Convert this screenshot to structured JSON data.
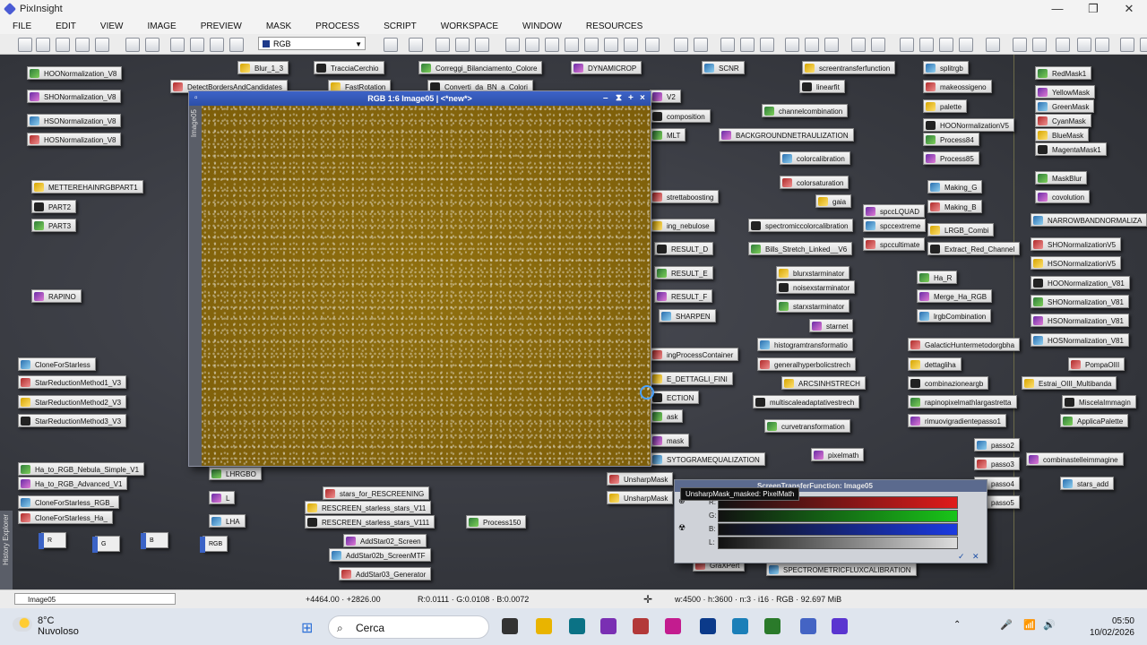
{
  "window": {
    "title": "PixInsight"
  },
  "menu": [
    "FILE",
    "EDIT",
    "VIEW",
    "IMAGE",
    "PREVIEW",
    "MASK",
    "PROCESS",
    "SCRIPT",
    "WORKSPACE",
    "WINDOW",
    "RESOURCES"
  ],
  "toolbar": {
    "rgb_select": "RGB"
  },
  "image_window": {
    "title": "RGB 1:6 Image05 | <*new*>",
    "side_label": "Image05"
  },
  "icons": [
    [
      "HOONormalization_V8",
      30,
      13
    ],
    [
      "SHONormalization_V8",
      30,
      39
    ],
    [
      "HSONormalization_V8",
      30,
      66
    ],
    [
      "HOSNormalization_V8",
      30,
      87
    ],
    [
      "METTEREHAINRGBPART1",
      35,
      140
    ],
    [
      "PART2",
      35,
      162
    ],
    [
      "PART3",
      35,
      183
    ],
    [
      "RAPINO",
      35,
      262
    ],
    [
      "CloneForStarless",
      20,
      338
    ],
    [
      "StarReductionMethod1_V3",
      20,
      358
    ],
    [
      "StarReductionMethod2_V3",
      20,
      380
    ],
    [
      "StarReductionMethod3_V3",
      20,
      401
    ],
    [
      "Ha_to_RGB_Nebula_Simple_V1",
      20,
      455
    ],
    [
      "Ha_to_RGB_Advanced_V1",
      20,
      471
    ],
    [
      "CloneForStarless_RGB_",
      20,
      492
    ],
    [
      "CloneForStarless_Ha_",
      20,
      509
    ],
    [
      "Blur_1_3",
      265,
      7
    ],
    [
      "TracciaCerchio",
      350,
      7
    ],
    [
      "Correggi_Bilanciamento_Colore",
      467,
      7
    ],
    [
      "DYNAMICROP",
      637,
      7
    ],
    [
      "SCNR",
      783,
      7
    ],
    [
      "DetectBordersAndCandidates",
      190,
      28
    ],
    [
      "FastRotation",
      366,
      28
    ],
    [
      "Converti_da_BN_a_Colori",
      477,
      28
    ],
    [
      "LHRGBO",
      233,
      460
    ],
    [
      "L",
      233,
      487
    ],
    [
      "LHA",
      233,
      513
    ],
    [
      "stars_for_RESCREENING",
      360,
      482
    ],
    [
      "RESCREEN_starless_stars_V11",
      340,
      498
    ],
    [
      "RESCREEN_starless_stars_V111",
      340,
      514
    ],
    [
      "Process150",
      520,
      514
    ],
    [
      "AddStar02_Screen",
      383,
      535
    ],
    [
      "AddStar02b_ScreenMTF",
      367,
      551
    ],
    [
      "AddStar03_Generator",
      378,
      572
    ],
    [
      "screentransferfunction",
      895,
      7
    ],
    [
      "linearfit",
      892,
      28
    ],
    [
      "channelcombination",
      850,
      55
    ],
    [
      "BACKGROUNDNETRAULIZATION",
      802,
      82
    ],
    [
      "colorcalibration",
      870,
      108
    ],
    [
      "colorsaturation",
      870,
      135
    ],
    [
      "gaia",
      910,
      156
    ],
    [
      "spectromiccolorcalibration",
      835,
      183
    ],
    [
      "Bills_Stretch_Linked__V6",
      835,
      209
    ],
    [
      "spccLQUAD",
      963,
      167
    ],
    [
      "spccextreme",
      963,
      183
    ],
    [
      "spccultimate",
      963,
      204
    ],
    [
      "blurxstarminator",
      866,
      236
    ],
    [
      "noisexstarminator",
      866,
      252
    ],
    [
      "starxstarminator",
      866,
      273
    ],
    [
      "starnet",
      903,
      295
    ],
    [
      "histogramtransformatio",
      845,
      316
    ],
    [
      "generalhyperbolicstrech",
      845,
      338
    ],
    [
      "ARCSINHSTRECH",
      872,
      359
    ],
    [
      "multiscaleadaptativestrech",
      840,
      380
    ],
    [
      "curvetransformation",
      853,
      407
    ],
    [
      "pixelmath",
      905,
      439
    ],
    [
      "SPECTROMETRICFLUXCALIBRATION",
      855,
      567
    ],
    [
      "strettaboosting",
      725,
      151
    ],
    [
      "ing_nebulose",
      725,
      183
    ],
    [
      "RESULT_D",
      730,
      209
    ],
    [
      "RESULT_E",
      730,
      236
    ],
    [
      "RESULT_F",
      730,
      262
    ],
    [
      "SHARPEN",
      735,
      284
    ],
    [
      "ingProcessContainer",
      725,
      327
    ],
    [
      "E_DETTAGLI_FINI",
      725,
      354
    ],
    [
      "ECTION",
      725,
      375
    ],
    [
      "ask",
      725,
      396
    ],
    [
      "mask",
      725,
      423
    ],
    [
      "SYTOGRAMEQUALIZATION",
      725,
      444
    ],
    [
      "UnsharpMask",
      677,
      466
    ],
    [
      "UnsharpMask",
      677,
      487
    ],
    [
      "composition",
      725,
      61
    ],
    [
      "MLT",
      725,
      82
    ],
    [
      "V2",
      725,
      39
    ],
    [
      "splitrgb",
      1030,
      7
    ],
    [
      "makeossigeno",
      1030,
      28
    ],
    [
      "palette",
      1030,
      50
    ],
    [
      "HOONormalizationV5",
      1030,
      71
    ],
    [
      "Process84",
      1030,
      87
    ],
    [
      "Process85",
      1030,
      108
    ],
    [
      "Making_G",
      1035,
      140
    ],
    [
      "Making_B",
      1035,
      162
    ],
    [
      "LRGB_Combi",
      1035,
      188
    ],
    [
      "Extract_Red_Channel",
      1035,
      209
    ],
    [
      "Ha_R",
      1023,
      241
    ],
    [
      "Merge_Ha_RGB",
      1023,
      262
    ],
    [
      "lrgbCombination",
      1023,
      284
    ],
    [
      "GalacticHuntermetodorgbha",
      1013,
      316
    ],
    [
      "dettagliha",
      1013,
      338
    ],
    [
      "combinazioneargb",
      1013,
      359
    ],
    [
      "rapinopixelmathlargastretta",
      1013,
      380
    ],
    [
      "rimuovigradientepasso1",
      1013,
      401
    ],
    [
      "passo2",
      1087,
      428
    ],
    [
      "passo3",
      1087,
      449
    ],
    [
      "passo4",
      1087,
      471
    ],
    [
      "passo5",
      1087,
      492
    ],
    [
      "RedMask1",
      1155,
      13
    ],
    [
      "YellowMask",
      1155,
      34
    ],
    [
      "GreenMask",
      1155,
      50
    ],
    [
      "CyanMask",
      1155,
      66
    ],
    [
      "BlueMask",
      1155,
      82
    ],
    [
      "MagentaMask1",
      1155,
      98
    ],
    [
      "MaskBlur",
      1155,
      130
    ],
    [
      "covolution",
      1155,
      151
    ],
    [
      "NARROWBANDNORMALIZA",
      1150,
      177
    ],
    [
      "SHONormalizationV5",
      1150,
      204
    ],
    [
      "HSONormalizationV5",
      1150,
      225
    ],
    [
      "HOONormalization_V81",
      1150,
      247
    ],
    [
      "SHONormalization_V81",
      1150,
      268
    ],
    [
      "HSONormalization_V81",
      1150,
      289
    ],
    [
      "HOSNormalization_V81",
      1150,
      311
    ],
    [
      "PompaOIII",
      1192,
      338
    ],
    [
      "Estrai_OIII_Multibanda",
      1140,
      359
    ],
    [
      "MiscelaImmagin",
      1185,
      380
    ],
    [
      "ApplicaPalette",
      1183,
      401
    ],
    [
      "combinastelleimmagine",
      1145,
      444
    ],
    [
      "stars_add",
      1183,
      471
    ],
    [
      "GraXPert",
      773,
      562
    ]
  ],
  "minimized_views": [
    "R",
    "G",
    "B",
    "RGB"
  ],
  "stf": {
    "title": "ScreenTransferFunction: Image05",
    "channels": [
      "R:",
      "G:",
      "B:",
      "L:"
    ],
    "tooltip": "UnsharpMask_masked: PixelMath"
  },
  "history_explorer": "History Explorer",
  "statusbar": {
    "view": "Image05",
    "coords": "+4464.00 · +2826.00",
    "values": "R:0.0111 · G:0.0108 · B:0.0072",
    "info": "w:4500 · h:3600 · n:3 · i16 · RGB · 92.697 MiB"
  },
  "taskbar": {
    "temp": "8°C",
    "weather": "Nuvoloso",
    "search_placeholder": "Cerca",
    "time": "05:50",
    "date": "10/02/2026"
  },
  "colors": {
    "image_bg": "#8a6a0f",
    "title_active": "#3d63c8"
  }
}
